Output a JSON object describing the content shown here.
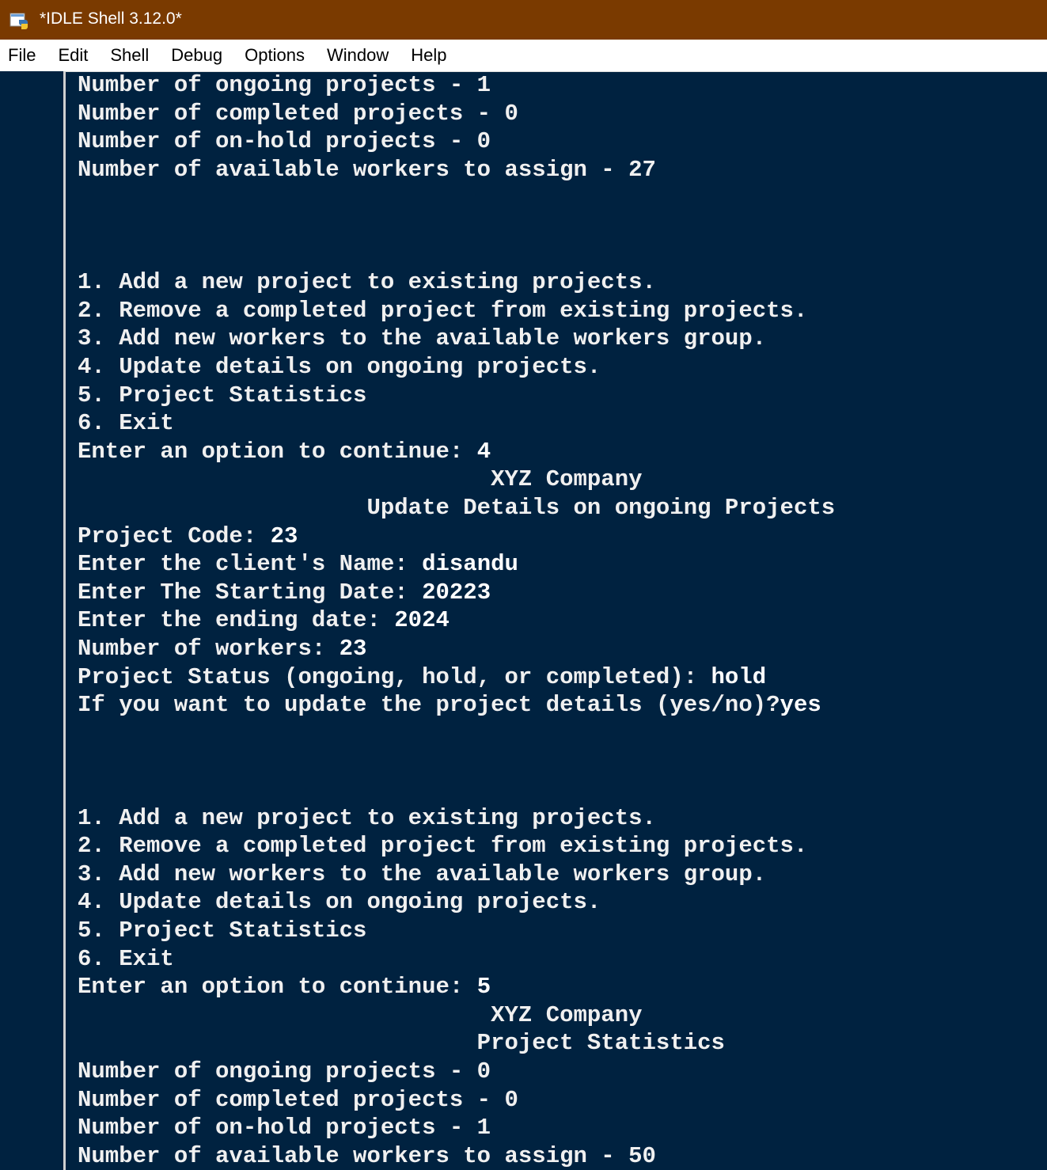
{
  "window": {
    "title": "*IDLE Shell 3.12.0*",
    "icon": "python-idle-icon"
  },
  "menu": {
    "items": [
      "File",
      "Edit",
      "Shell",
      "Debug",
      "Options",
      "Window",
      "Help"
    ]
  },
  "console": {
    "lines": [
      {
        "out": "Number of ongoing projects - 1",
        "in": ""
      },
      {
        "out": "Number of completed projects - 0",
        "in": ""
      },
      {
        "out": "Number of on-hold projects - 0",
        "in": ""
      },
      {
        "out": "Number of available workers to assign - 27",
        "in": ""
      },
      {
        "out": "",
        "in": ""
      },
      {
        "out": "",
        "in": ""
      },
      {
        "out": "",
        "in": ""
      },
      {
        "out": "1. Add a new project to existing projects.",
        "in": ""
      },
      {
        "out": "2. Remove a completed project from existing projects.",
        "in": ""
      },
      {
        "out": "3. Add new workers to the available workers group.",
        "in": ""
      },
      {
        "out": "4. Update details on ongoing projects.",
        "in": ""
      },
      {
        "out": "5. Project Statistics",
        "in": ""
      },
      {
        "out": "6. Exit",
        "in": ""
      },
      {
        "out": "Enter an option to continue: ",
        "in": "4"
      },
      {
        "out": "                              XYZ Company",
        "in": ""
      },
      {
        "out": "                     Update Details on ongoing Projects",
        "in": ""
      },
      {
        "out": "Project Code: ",
        "in": "23"
      },
      {
        "out": "Enter the client's Name: ",
        "in": "disandu"
      },
      {
        "out": "Enter The Starting Date: ",
        "in": "20223"
      },
      {
        "out": "Enter the ending date: ",
        "in": "2024"
      },
      {
        "out": "Number of workers: ",
        "in": "23"
      },
      {
        "out": "Project Status (ongoing, hold, or completed): ",
        "in": "hold"
      },
      {
        "out": "If you want to update the project details (yes/no)?",
        "in": "yes"
      },
      {
        "out": "",
        "in": ""
      },
      {
        "out": "",
        "in": ""
      },
      {
        "out": "",
        "in": ""
      },
      {
        "out": "1. Add a new project to existing projects.",
        "in": ""
      },
      {
        "out": "2. Remove a completed project from existing projects.",
        "in": ""
      },
      {
        "out": "3. Add new workers to the available workers group.",
        "in": ""
      },
      {
        "out": "4. Update details on ongoing projects.",
        "in": ""
      },
      {
        "out": "5. Project Statistics",
        "in": ""
      },
      {
        "out": "6. Exit",
        "in": ""
      },
      {
        "out": "Enter an option to continue: ",
        "in": "5"
      },
      {
        "out": "                              XYZ Company",
        "in": ""
      },
      {
        "out": "                             Project Statistics",
        "in": ""
      },
      {
        "out": "Number of ongoing projects - 0",
        "in": ""
      },
      {
        "out": "Number of completed projects - 0",
        "in": ""
      },
      {
        "out": "Number of on-hold projects - 1",
        "in": ""
      },
      {
        "out": "Number of available workers to assign - 50",
        "in": ""
      }
    ]
  },
  "colors": {
    "titlebar": "#7a3a00",
    "console_bg": "#002240",
    "text": "#ffffff"
  }
}
